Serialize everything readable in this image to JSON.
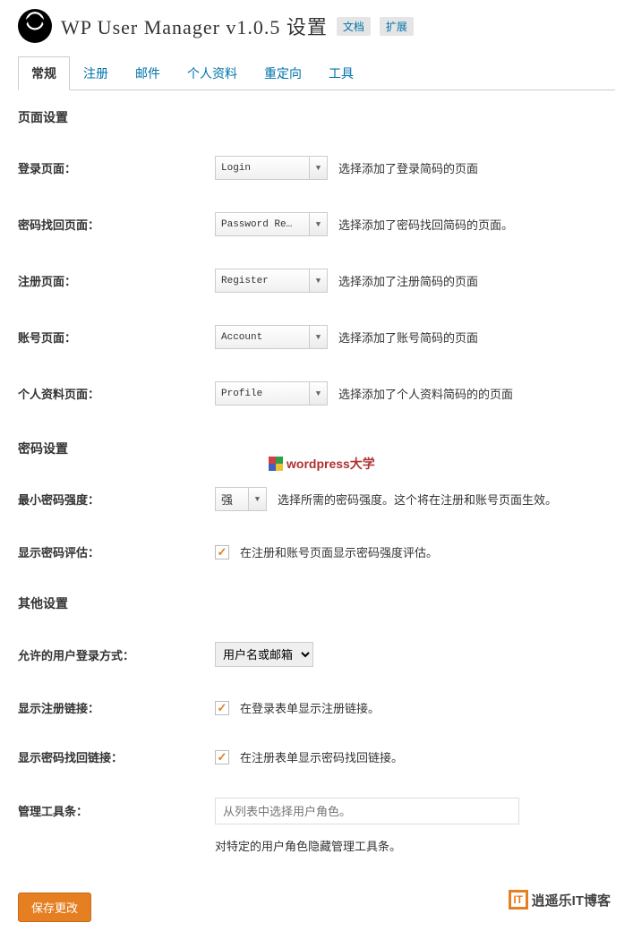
{
  "header": {
    "title": "WP User Manager v1.0.5 设置",
    "tag_docs": "文档",
    "tag_ext": "扩展"
  },
  "tabs": [
    "常规",
    "注册",
    "邮件",
    "个人资料",
    "重定向",
    "工具"
  ],
  "section_pages": "页面设置",
  "rows_pages": {
    "login": {
      "label": "登录页面：",
      "value": "Login",
      "hint": "选择添加了登录简码的页面"
    },
    "password": {
      "label": "密码找回页面：",
      "value": "Password Re…",
      "hint": "选择添加了密码找回简码的页面。"
    },
    "register": {
      "label": "注册页面：",
      "value": "Register",
      "hint": "选择添加了注册简码的页面"
    },
    "account": {
      "label": "账号页面：",
      "value": "Account",
      "hint": "选择添加了账号简码的页面"
    },
    "profile": {
      "label": "个人资料页面：",
      "value": "Profile",
      "hint": "选择添加了个人资料简码的的页面"
    }
  },
  "section_pwd": "密码设置",
  "rows_pwd": {
    "strength": {
      "label": "最小密码强度：",
      "value": "强",
      "hint": "选择所需的密码强度。这个将在注册和账号页面生效。"
    },
    "eval": {
      "label": "显示密码评估：",
      "hint": "在注册和账号页面显示密码强度评估。"
    }
  },
  "section_other": "其他设置",
  "rows_other": {
    "login_method": {
      "label": "允许的用户登录方式：",
      "value": "用户名或邮箱"
    },
    "reg_link": {
      "label": "显示注册链接：",
      "hint": "在登录表单显示注册链接。"
    },
    "pwd_link": {
      "label": "显示密码找回链接：",
      "hint": "在注册表单显示密码找回链接。"
    },
    "admin_bar": {
      "label": "管理工具条：",
      "placeholder": "从列表中选择用户角色。",
      "hint": "对特定的用户角色隐藏管理工具条。"
    }
  },
  "save_label": "保存更改",
  "watermark": "wordpress大学",
  "footer": {
    "icon": "IT",
    "text": "逍遥乐IT博客"
  }
}
